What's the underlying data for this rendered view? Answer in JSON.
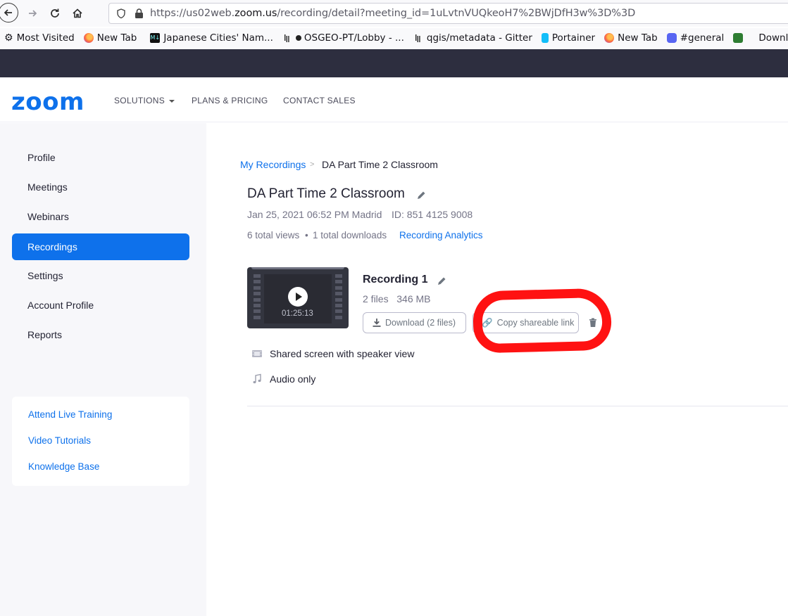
{
  "browser": {
    "url_prefix": "https://us02web.",
    "url_domain": "zoom.us",
    "url_suffix": "/recording/detail?meeting_id=1uLvtnVUQkeoH7%2BWjDfH3w%3D%3D",
    "bookmarks": [
      {
        "label": "Most Visited",
        "icon": "gear-icon"
      },
      {
        "label": "New Tab",
        "icon": "firefox-icon"
      },
      {
        "label": "Japanese Cities' Nam...",
        "icon": "mb-icon"
      },
      {
        "label": "OSGEO-PT/Lobby - ...",
        "icon": "gitter-icon"
      },
      {
        "label": "qgis/metadata - Gitter",
        "icon": "gitter-icon"
      },
      {
        "label": "Portainer",
        "icon": "portainer-icon"
      },
      {
        "label": "New Tab",
        "icon": "firefox-icon"
      },
      {
        "label": "#general",
        "icon": "discord-icon"
      },
      {
        "label": "Download MP",
        "icon": "green-icon"
      }
    ]
  },
  "header": {
    "logo": "zoom",
    "nav": [
      "SOLUTIONS",
      "PLANS & PRICING",
      "CONTACT SALES"
    ],
    "accent": "#0e71eb"
  },
  "sidebar": {
    "items": [
      "Profile",
      "Meetings",
      "Webinars",
      "Recordings",
      "Settings",
      "Account Profile",
      "Reports"
    ],
    "active": "Recordings",
    "help_links": [
      "Attend Live Training",
      "Video Tutorials",
      "Knowledge Base"
    ]
  },
  "breadcrumb": {
    "parent": "My Recordings",
    "separator": ">",
    "current": "DA Part Time 2 Classroom"
  },
  "meeting": {
    "title": "DA Part Time 2 Classroom",
    "datetime": "Jan 25, 2021 06:52 PM Madrid",
    "id": "ID: 851 4125 9008",
    "views": "6 total views",
    "dot": "•",
    "downloads": "1 total downloads",
    "analytics": "Recording Analytics"
  },
  "recording": {
    "title": "Recording 1",
    "files": "2 files",
    "size": "346 MB",
    "duration": "01:25:13",
    "download_label": "Download (2 files)",
    "copy_label": "Copy shareable link",
    "file_list": [
      {
        "label": "Shared screen with speaker view",
        "icon": "video-file-icon"
      },
      {
        "label": "Audio only",
        "icon": "music-note-icon"
      }
    ]
  }
}
